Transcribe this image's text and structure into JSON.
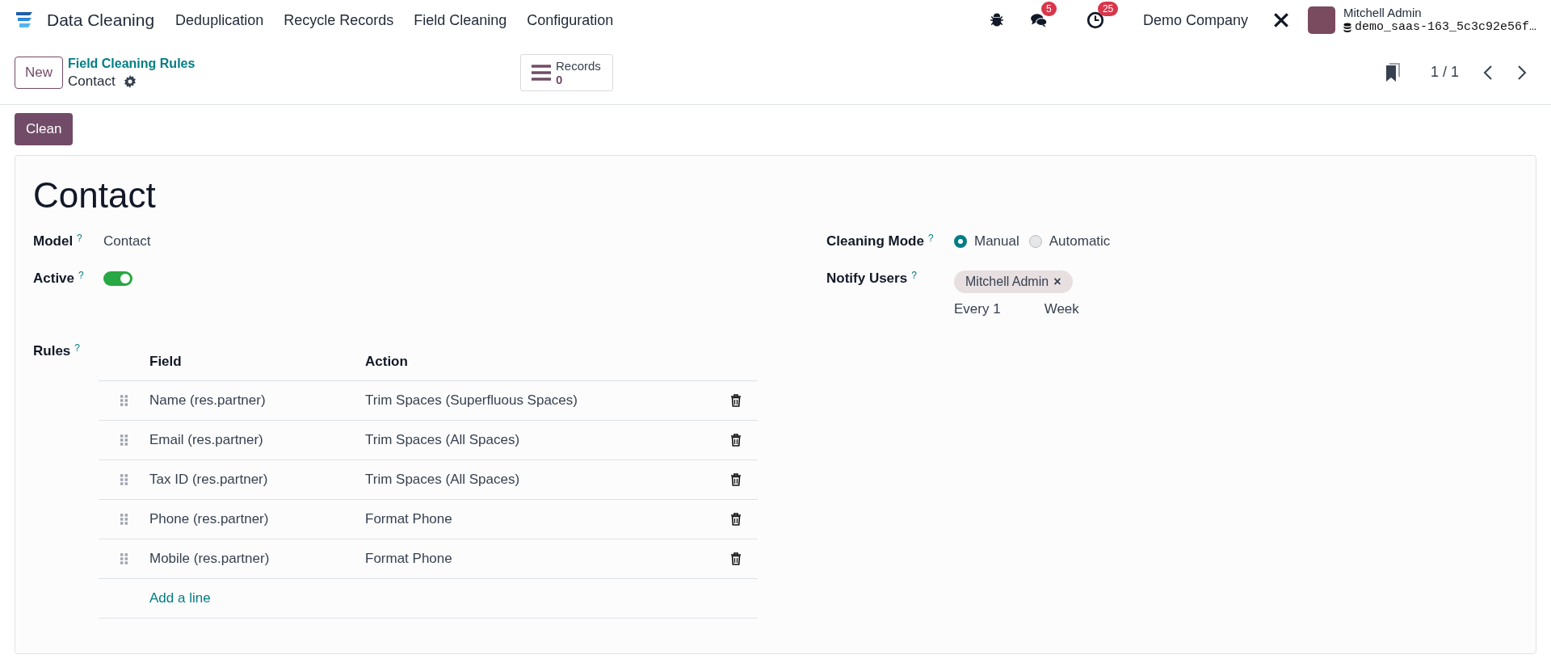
{
  "app": {
    "name": "Data Cleaning",
    "menu": [
      {
        "label": "Deduplication"
      },
      {
        "label": "Recycle Records"
      },
      {
        "label": "Field Cleaning"
      },
      {
        "label": "Configuration"
      }
    ]
  },
  "systray": {
    "messages_count": "5",
    "activities_count": "25",
    "company": "Demo Company",
    "user": {
      "name": "Mitchell Admin",
      "database": "demo_saas-163_5c3c92e56f…"
    }
  },
  "control_panel": {
    "new_button": "New",
    "breadcrumb": "Field Cleaning Rules",
    "record_title": "Contact",
    "records_button": {
      "label": "Records",
      "count": "0"
    },
    "pager": "1 / 1"
  },
  "actions": [
    "Clean"
  ],
  "form": {
    "title": "Contact",
    "left_fields": [
      {
        "kind": "text",
        "label": "Model",
        "help": "?",
        "value": "Contact"
      },
      {
        "kind": "toggle",
        "label": "Active",
        "help": "?",
        "on": true
      }
    ],
    "cleaning_mode": {
      "label": "Cleaning Mode",
      "help": "?",
      "options": [
        {
          "label": "Manual",
          "selected": true
        },
        {
          "label": "Automatic",
          "selected": false
        }
      ]
    },
    "notify_users": {
      "label": "Notify Users",
      "help": "?",
      "tags": [
        {
          "label": "Mitchell Admin",
          "remove": "×"
        }
      ],
      "schedule": [
        "Every 1",
        "Week"
      ]
    },
    "rules": {
      "label": "Rules",
      "help": "?",
      "columns": [
        "Field",
        "Action"
      ],
      "rows": [
        {
          "field": "Name (res.partner)",
          "action": "Trim Spaces (Superfluous Spaces)"
        },
        {
          "field": "Email (res.partner)",
          "action": "Trim Spaces (All Spaces)"
        },
        {
          "field": "Tax ID (res.partner)",
          "action": "Trim Spaces (All Spaces)"
        },
        {
          "field": "Phone (res.partner)",
          "action": "Format Phone"
        },
        {
          "field": "Mobile (res.partner)",
          "action": "Format Phone"
        }
      ],
      "add_line": "Add a line"
    }
  }
}
